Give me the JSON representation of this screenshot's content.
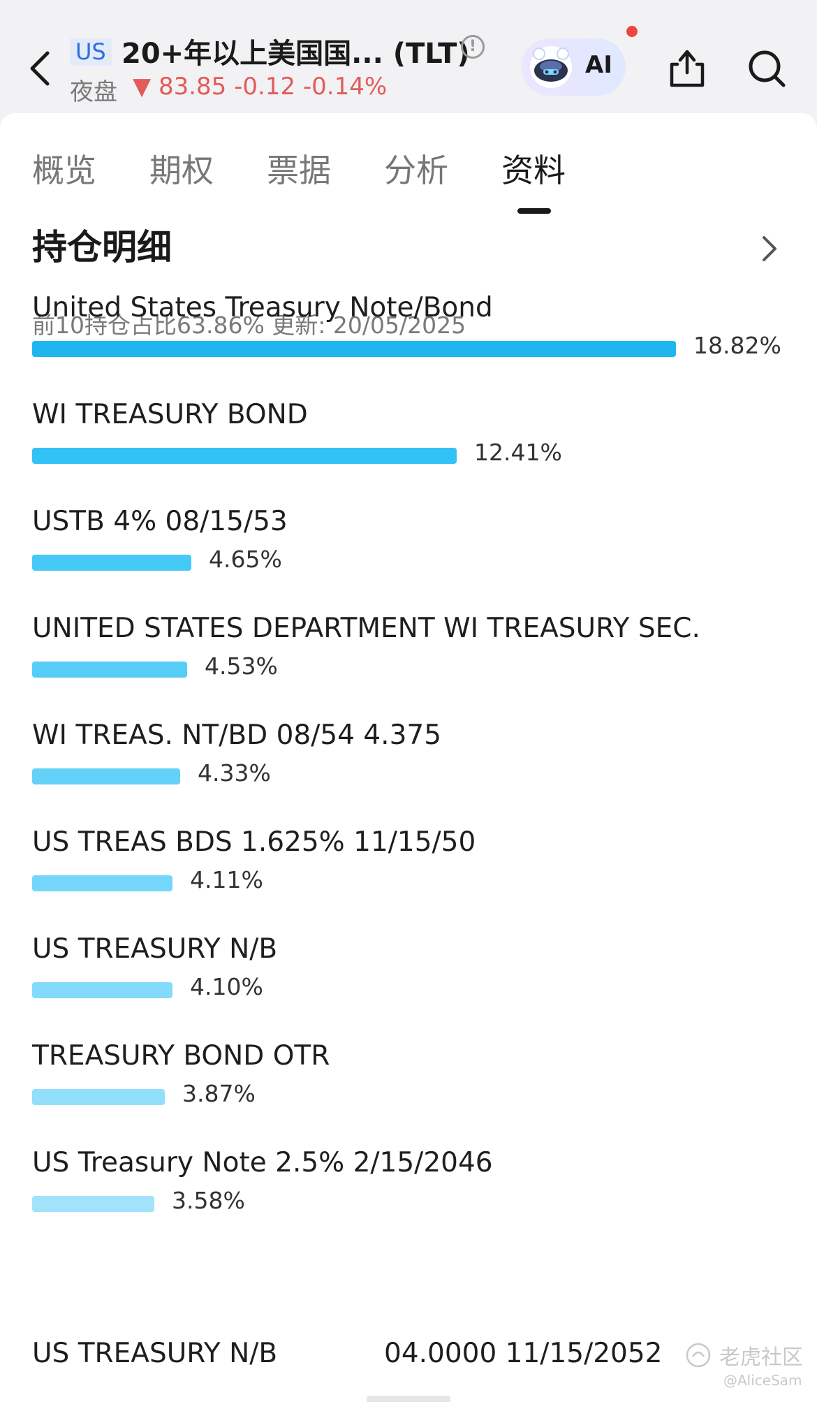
{
  "header": {
    "region_tag": "US",
    "title": "20+年以上美国国... (TLT)",
    "session": "夜盘",
    "quote": "▼ 83.85 -0.12 -0.14%",
    "ai_label": "AI",
    "icons": [
      "back-arrow-icon",
      "info-icon",
      "ai-robot-icon",
      "share-icon",
      "search-icon"
    ]
  },
  "tabs": [
    {
      "label": "概览",
      "active": false
    },
    {
      "label": "期权",
      "active": false
    },
    {
      "label": "票据",
      "active": false
    },
    {
      "label": "分析",
      "active": false
    },
    {
      "label": "资料",
      "active": true
    }
  ],
  "section": {
    "title": "持仓明细",
    "summary": "前10持仓占比63.86% 更新: 20/05/2025"
  },
  "holdings": [
    {
      "name": "United States Treasury Note/Bond",
      "percent": 18.82,
      "percent_label": "18.82%",
      "color": "#1fb6f0"
    },
    {
      "name": "WI TREASURY BOND",
      "percent": 12.41,
      "percent_label": "12.41%",
      "color": "#33c2f5"
    },
    {
      "name": "USTB 4% 08/15/53",
      "percent": 4.65,
      "percent_label": "4.65%",
      "color": "#45c9f7"
    },
    {
      "name": "UNITED STATES DEPARTMENT WI TREASURY SEC.",
      "percent": 4.53,
      "percent_label": "4.53%",
      "color": "#55cdf8"
    },
    {
      "name": "WI TREAS. NT/BD 08/54 4.375",
      "percent": 4.33,
      "percent_label": "4.33%",
      "color": "#63d1f8"
    },
    {
      "name": "US TREAS BDS 1.625% 11/15/50",
      "percent": 4.11,
      "percent_label": "4.11%",
      "color": "#74d6fa"
    },
    {
      "name": "US TREASURY N/B",
      "percent": 4.1,
      "percent_label": "4.10%",
      "color": "#84dafa"
    },
    {
      "name": "TREASURY BOND  OTR",
      "percent": 3.87,
      "percent_label": "3.87%",
      "color": "#92dffb"
    },
    {
      "name": "US Treasury Note 2.5% 2/15/2046",
      "percent": 3.58,
      "percent_label": "3.58%",
      "color": "#a2e3fb"
    }
  ],
  "last_holding": {
    "name": "US TREASURY N/B",
    "detail": "04.0000 11/15/2052"
  },
  "watermark": {
    "brand": "老虎社区",
    "user": "@AliceSam"
  }
}
